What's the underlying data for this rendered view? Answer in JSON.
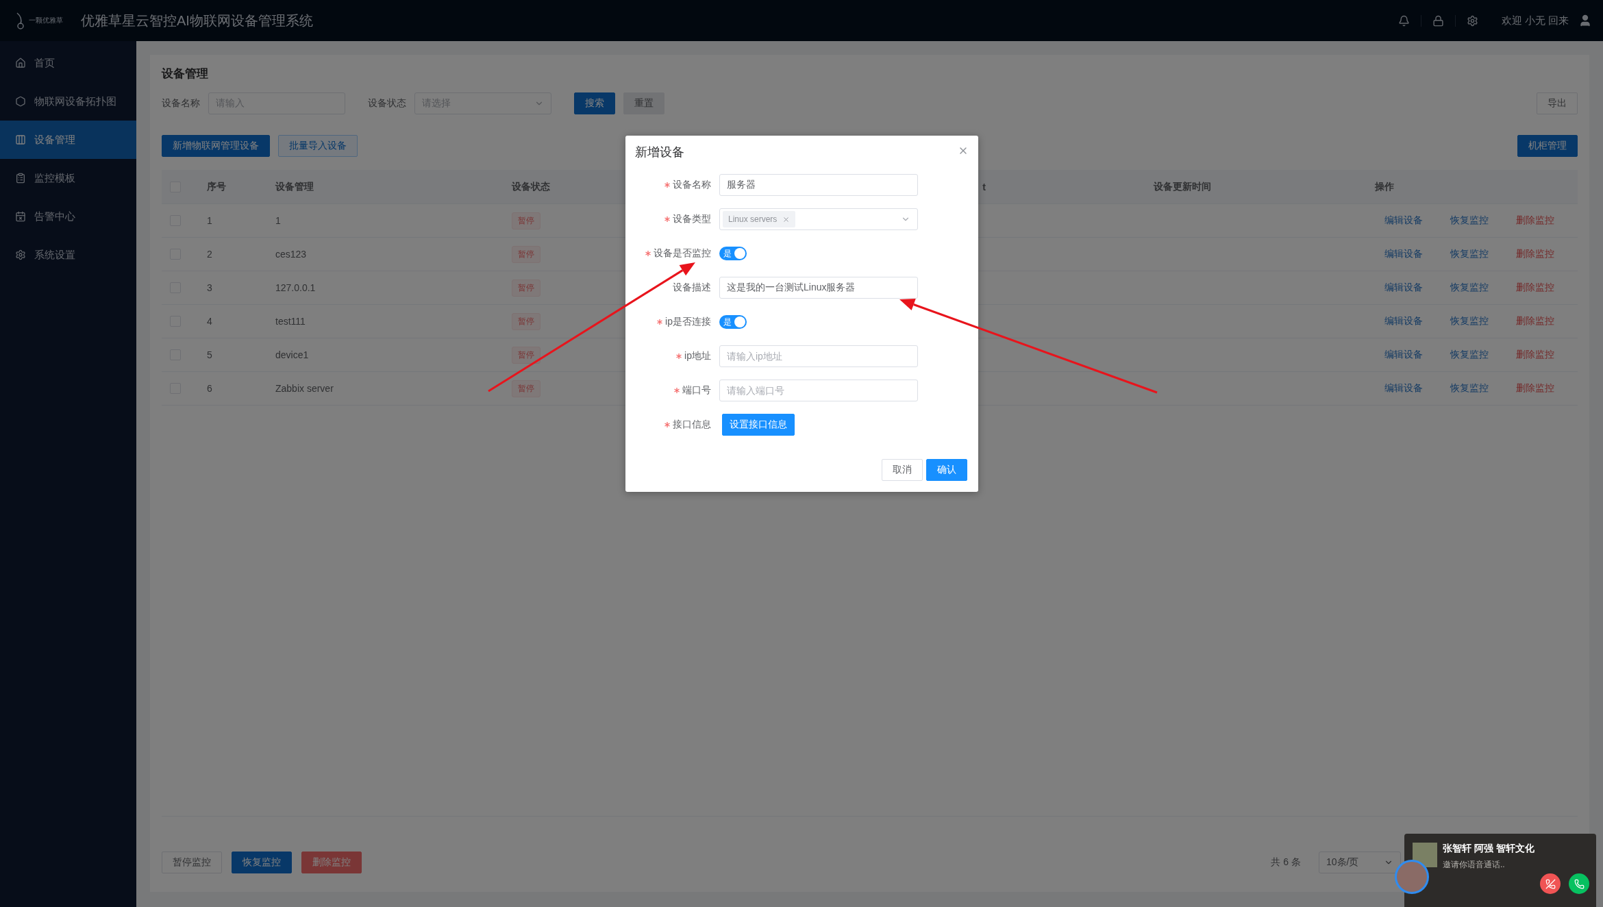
{
  "header": {
    "logo_text": "一颗优雅草",
    "title": "优雅草星云智控AI物联网设备管理系统",
    "welcome": "欢迎 小无 回来"
  },
  "sidebar": {
    "items": [
      {
        "label": "首页",
        "selected": false
      },
      {
        "label": "物联网设备拓扑图",
        "selected": false
      },
      {
        "label": "设备管理",
        "selected": true
      },
      {
        "label": "监控模板",
        "selected": false
      },
      {
        "label": "告警中心",
        "selected": false
      },
      {
        "label": "系统设置",
        "selected": false
      }
    ]
  },
  "page": {
    "title": "设备管理",
    "filters": [
      {
        "label": "设备名称",
        "placeholder": "请输入",
        "kind": "input"
      },
      {
        "label": "设备状态",
        "placeholder": "请选择",
        "kind": "select"
      }
    ],
    "search_button": "搜索",
    "reset_button": "重置",
    "export_button": "导出",
    "actions": [
      {
        "label": "新增物联网管理设备",
        "kind": "primary"
      },
      {
        "label": "批量导入设备",
        "kind": "plain"
      }
    ],
    "cabinet_button": "机柜管理"
  },
  "table": {
    "all_checked": false,
    "columns": [
      "序号",
      "设备管理",
      "设备状态",
      "t",
      "设备更新时间",
      "操作"
    ],
    "rows": [
      {
        "checked": false,
        "index": "1",
        "name": "1",
        "status": "暂停",
        "actions": [
          {
            "label": "编辑设备",
            "kind": "link"
          },
          {
            "label": "恢复监控",
            "kind": "link"
          },
          {
            "label": "删除监控",
            "kind": "danger"
          }
        ]
      },
      {
        "checked": false,
        "index": "2",
        "name": "ces123",
        "status": "暂停",
        "actions": [
          {
            "label": "编辑设备",
            "kind": "link"
          },
          {
            "label": "恢复监控",
            "kind": "link"
          },
          {
            "label": "删除监控",
            "kind": "danger"
          }
        ]
      },
      {
        "checked": false,
        "index": "3",
        "name": "127.0.0.1",
        "status": "暂停",
        "actions": [
          {
            "label": "编辑设备",
            "kind": "link"
          },
          {
            "label": "恢复监控",
            "kind": "link"
          },
          {
            "label": "删除监控",
            "kind": "danger"
          }
        ]
      },
      {
        "checked": false,
        "index": "4",
        "name": "test111",
        "status": "暂停",
        "actions": [
          {
            "label": "编辑设备",
            "kind": "link"
          },
          {
            "label": "恢复监控",
            "kind": "link"
          },
          {
            "label": "删除监控",
            "kind": "danger"
          }
        ]
      },
      {
        "checked": false,
        "index": "5",
        "name": "device1",
        "status": "暂停",
        "actions": [
          {
            "label": "编辑设备",
            "kind": "link"
          },
          {
            "label": "恢复监控",
            "kind": "link"
          },
          {
            "label": "删除监控",
            "kind": "danger"
          }
        ]
      },
      {
        "checked": false,
        "index": "6",
        "name": "Zabbix server",
        "status": "暂停",
        "actions": [
          {
            "label": "编辑设备",
            "kind": "link"
          },
          {
            "label": "恢复监控",
            "kind": "link"
          },
          {
            "label": "删除监控",
            "kind": "danger"
          }
        ]
      }
    ]
  },
  "bulk_actions": [
    {
      "label": "暂停监控",
      "kind": "plain"
    },
    {
      "label": "恢复监控",
      "kind": "primary"
    },
    {
      "label": "删除监控",
      "kind": "danger"
    }
  ],
  "pagination": {
    "total": "共 6 条",
    "page_size": "10条/页"
  },
  "dialog": {
    "title": "新增设备",
    "fields": [
      {
        "label": "设备名称",
        "required": true,
        "kind": "input",
        "value": "服务器"
      },
      {
        "label": "设备类型",
        "required": true,
        "kind": "tags",
        "tags": [
          "Linux servers"
        ]
      },
      {
        "label": "设备是否监控",
        "required": true,
        "kind": "switch",
        "on": true,
        "text": "是"
      },
      {
        "label": "设备描述",
        "required": false,
        "kind": "input",
        "value": "这是我的一台测试Linux服务器"
      },
      {
        "label": "ip是否连接",
        "required": true,
        "kind": "switch",
        "on": true,
        "text": "是"
      },
      {
        "label": "ip地址",
        "required": true,
        "kind": "input",
        "placeholder": "请输入ip地址"
      },
      {
        "label": "端口号",
        "required": true,
        "kind": "input",
        "placeholder": "请输入端口号"
      },
      {
        "label": "接口信息",
        "required": true,
        "kind": "button",
        "button": "设置接口信息"
      }
    ],
    "buttons": [
      {
        "label": "取消",
        "kind": "plain"
      },
      {
        "label": "确认",
        "kind": "primary"
      }
    ]
  },
  "call_notification": {
    "title": "张智轩 阿强 智轩文化",
    "subtitle": "邀请你语音通话.."
  }
}
